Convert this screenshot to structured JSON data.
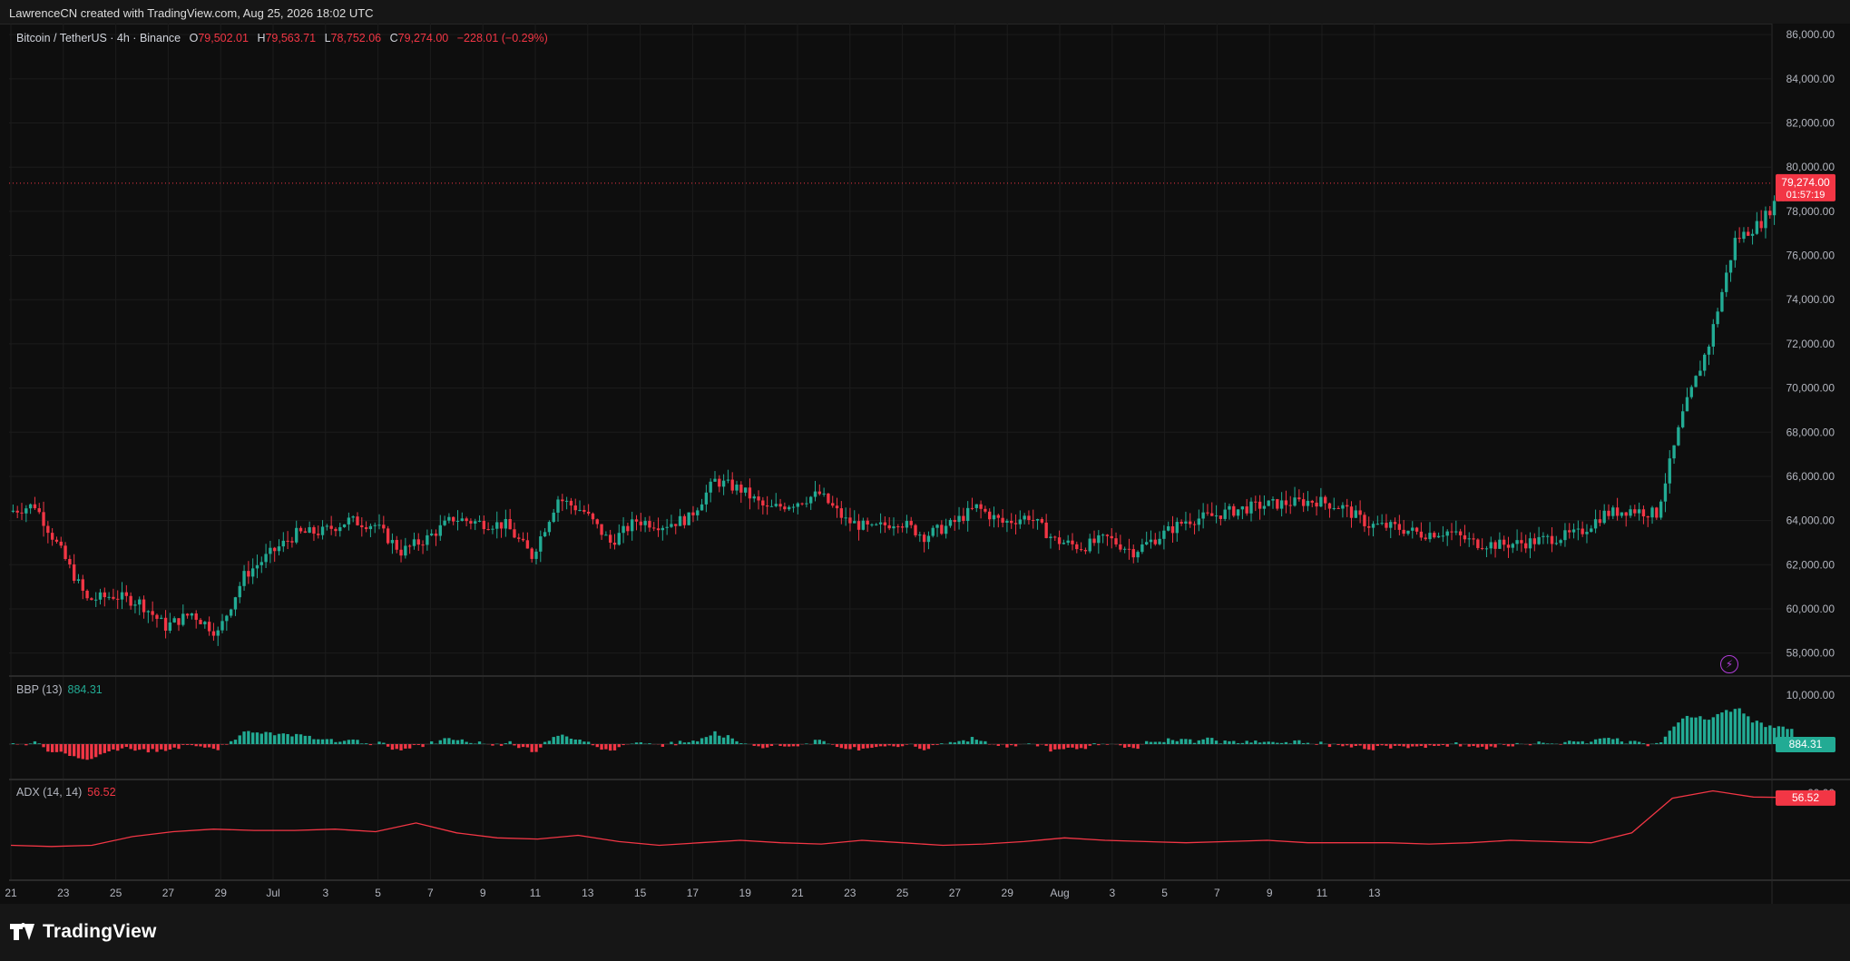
{
  "header": {
    "credit": "LawrenceCN created with TradingView.com, Aug 25, 2026 18:02 UTC"
  },
  "legend": {
    "symbol": "Bitcoin / TetherUS · 4h · Binance",
    "o_label": "O",
    "o_value": "79,502.01",
    "h_label": "H",
    "h_value": "79,563.71",
    "l_label": "L",
    "l_value": "78,752.06",
    "c_label": "C",
    "c_value": "79,274.00",
    "change": "−228.01 (−0.29%)"
  },
  "price_axis": {
    "labels": [
      "86,000.00",
      "84,000.00",
      "82,000.00",
      "80,000.00",
      "78,000.00",
      "76,000.00",
      "74,000.00",
      "72,000.00",
      "70,000.00",
      "68,000.00",
      "66,000.00",
      "64,000.00",
      "62,000.00",
      "60,000.00",
      "58,000.00"
    ],
    "last_price_label": "79,274.00",
    "countdown_label": "01:57:19"
  },
  "bbp": {
    "name": "BBP (13)",
    "value": "884.31",
    "axis_label": "10,000.00"
  },
  "adx": {
    "name": "ADX (14, 14)",
    "value": "56.52",
    "axis_label": "60.00"
  },
  "time_axis": {
    "labels": [
      "21",
      "23",
      "25",
      "27",
      "29",
      "Jul",
      "3",
      "5",
      "7",
      "9",
      "11",
      "13",
      "15",
      "17",
      "19",
      "21",
      "23",
      "25",
      "27",
      "29",
      "Aug",
      "3",
      "5",
      "7",
      "9",
      "11",
      "13"
    ]
  },
  "footer": {
    "brand": "TradingView"
  },
  "colors": {
    "up": "#22ab94",
    "down": "#f23645",
    "adx_line": "#f23645",
    "background": "#0e0e0e",
    "grid": "#1c1c1c"
  },
  "chart_data": [
    {
      "type": "candlestick",
      "title": "Bitcoin / TetherUS · 4h · Binance",
      "ylim": [
        57000,
        86500
      ],
      "y_ticks": [
        86000,
        84000,
        82000,
        80000,
        78000,
        76000,
        74000,
        72000,
        70000,
        68000,
        66000,
        64000,
        62000,
        60000,
        58000
      ],
      "x_ticks": [
        "21",
        "23",
        "25",
        "27",
        "29",
        "Jul",
        "3",
        "5",
        "7",
        "9",
        "11",
        "13",
        "15",
        "17",
        "19",
        "21",
        "23",
        "25",
        "27",
        "29",
        "Aug",
        "3",
        "5",
        "7",
        "9",
        "11",
        "13"
      ],
      "last_price": 79274.0,
      "close_path_approx": {
        "x_day_index": [
          0,
          1,
          2,
          3,
          4,
          5,
          6,
          7,
          8,
          9,
          10,
          11,
          12,
          13,
          14,
          15,
          16,
          17,
          18,
          19,
          20,
          21,
          22,
          23,
          24,
          25,
          26,
          27,
          28,
          29,
          30,
          31,
          32,
          33,
          34,
          35,
          36,
          37,
          38,
          39,
          40,
          41,
          42,
          43,
          44,
          45,
          46,
          47,
          48,
          49,
          50,
          51,
          52,
          53,
          54,
          55,
          56,
          57,
          58,
          59,
          60,
          61,
          62,
          63,
          64,
          65,
          66,
          67,
          68
        ],
        "close": [
          64400,
          64700,
          62600,
          60400,
          60600,
          60300,
          59200,
          59800,
          58900,
          61500,
          62500,
          63400,
          63500,
          64000,
          63800,
          62600,
          63200,
          64100,
          63900,
          63800,
          62400,
          65000,
          64400,
          63000,
          64000,
          63800,
          64100,
          65800,
          65400,
          64500,
          64800,
          65200,
          64000,
          63600,
          64000,
          63300,
          63800,
          64600,
          63900,
          64200,
          63100,
          62800,
          63200,
          62600,
          63300,
          64000,
          64200,
          64500,
          64700,
          64800,
          64900,
          64600,
          63800,
          63700,
          63400,
          63500,
          63000,
          62900,
          63000,
          63200,
          63400,
          64300,
          64500,
          64300,
          68800,
          72000,
          76700,
          77500,
          79274
        ]
      }
    },
    {
      "type": "bar",
      "title": "BBP (13)",
      "last_value": 884.31,
      "series": [
        {
          "name": "BBP (13)",
          "note": "histogram of bull/bear power, green above zero, red below"
        }
      ]
    },
    {
      "type": "line",
      "title": "ADX (14, 14)",
      "last_value": 56.52,
      "y_tick": 60,
      "series": [
        {
          "name": "ADX (14, 14)",
          "values": [
            18,
            17,
            18,
            25,
            29,
            31,
            30,
            30,
            31,
            29,
            36,
            28,
            24,
            23,
            26,
            21,
            18,
            20,
            22,
            20,
            19,
            22,
            20,
            18,
            19,
            21,
            24,
            22,
            21,
            20,
            21,
            22,
            20,
            20,
            20,
            19,
            20,
            22,
            21,
            20,
            28,
            56,
            62,
            57,
            56.52
          ]
        }
      ]
    }
  ]
}
